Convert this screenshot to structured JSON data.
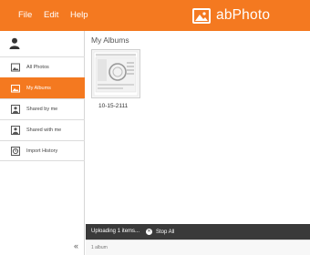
{
  "menu": {
    "file": "File",
    "edit": "Edit",
    "help": "Help"
  },
  "app": {
    "name": "abPhoto"
  },
  "sidebar": {
    "items": [
      {
        "label": "All Photos",
        "icon": "photo-icon"
      },
      {
        "label": "My Albums",
        "icon": "album-icon"
      },
      {
        "label": "Shared by me",
        "icon": "shared-by-me-icon"
      },
      {
        "label": "Shared with me",
        "icon": "shared-with-me-icon"
      },
      {
        "label": "Import History",
        "icon": "history-icon"
      }
    ],
    "collapse": "«"
  },
  "main": {
    "title": "My Albums",
    "albums": [
      {
        "label": "10-15-2111"
      }
    ]
  },
  "status": {
    "uploading": "Uploading 1 items...",
    "stop": "Stop All"
  },
  "footer": {
    "count": "1 album"
  },
  "colors": {
    "accent": "#f47920",
    "status_bar": "#3a3a3a"
  }
}
